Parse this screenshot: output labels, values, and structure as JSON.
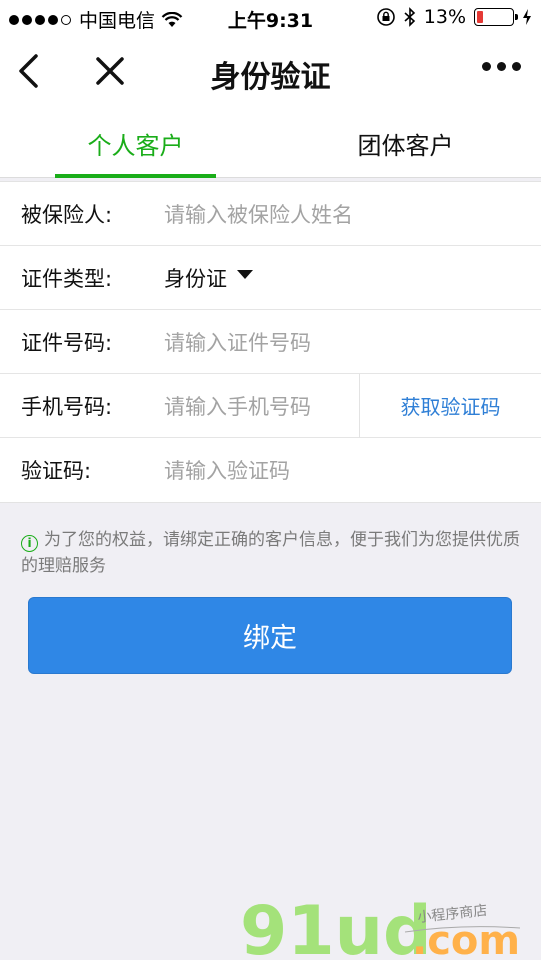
{
  "status_bar": {
    "carrier": "中国电信",
    "time": "上午9:31",
    "battery": "13%"
  },
  "nav": {
    "title": "身份验证"
  },
  "tabs": [
    {
      "label": "个人客户",
      "active": true
    },
    {
      "label": "团体客户",
      "active": false
    }
  ],
  "form": {
    "insured": {
      "label": "被保险人:",
      "placeholder": "请输入被保险人姓名"
    },
    "id_type": {
      "label": "证件类型:",
      "value": "身份证"
    },
    "id_number": {
      "label": "证件号码:",
      "placeholder": "请输入证件号码"
    },
    "phone": {
      "label": "手机号码:",
      "placeholder": "请输入手机号码",
      "code_button": "获取验证码"
    },
    "code": {
      "label": "验证码:",
      "placeholder": "请输入验证码"
    }
  },
  "tip": "为了您的权益，请绑定正确的客户信息，便于我们为您提供优质的理赔服务",
  "bind_button": "绑定",
  "watermark": {
    "logo": "91ud",
    "domain": ".com",
    "tagline": "小程序商店"
  },
  "colors": {
    "accent_green": "#1aad19",
    "button_blue": "#2f87e6",
    "link_blue": "#2f7fd6",
    "battery_red": "#e53935"
  }
}
